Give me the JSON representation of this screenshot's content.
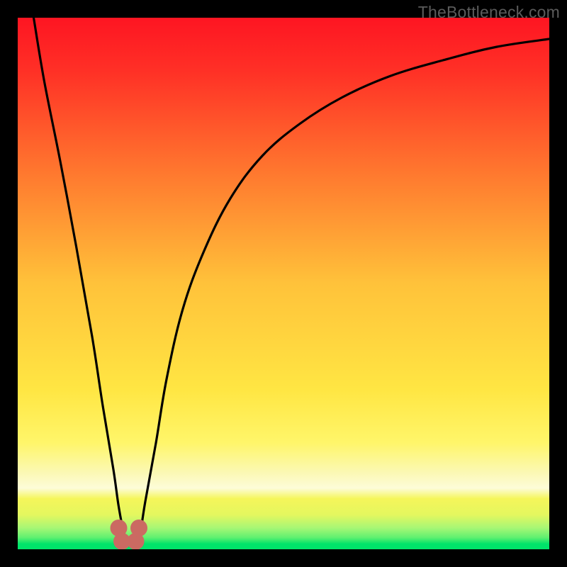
{
  "watermark": "TheBottleneck.com",
  "colors": {
    "frame": "#000000",
    "top": "#fe1522",
    "mid": "#ffe643",
    "cream": "#fbf8b3",
    "yellow2": "#f5f65a",
    "lightgreen": "#a6f775",
    "green": "#00e46a",
    "curve": "#000000",
    "marker": "#cb6a62"
  },
  "gradient_stops": [
    {
      "offset": 0.0,
      "color": "#fe1522"
    },
    {
      "offset": 0.1,
      "color": "#ff3026"
    },
    {
      "offset": 0.3,
      "color": "#ff7b2f"
    },
    {
      "offset": 0.5,
      "color": "#ffc23a"
    },
    {
      "offset": 0.7,
      "color": "#ffe643"
    },
    {
      "offset": 0.8,
      "color": "#fff66a"
    },
    {
      "offset": 0.855,
      "color": "#fbf8b3"
    },
    {
      "offset": 0.885,
      "color": "#fdfcd8"
    },
    {
      "offset": 0.905,
      "color": "#f5f65a"
    },
    {
      "offset": 0.935,
      "color": "#e4f75f"
    },
    {
      "offset": 0.96,
      "color": "#a6f775"
    },
    {
      "offset": 0.978,
      "color": "#5ff070"
    },
    {
      "offset": 0.99,
      "color": "#00e46a"
    },
    {
      "offset": 1.0,
      "color": "#00e46a"
    }
  ],
  "chart_data": {
    "type": "line",
    "title": "",
    "xlabel": "",
    "ylabel": "",
    "xlim": [
      0,
      100
    ],
    "ylim": [
      0,
      100
    ],
    "series": [
      {
        "name": "bottleneck-curve",
        "x": [
          3,
          5,
          8,
          11,
          14,
          16,
          18,
          19,
          20,
          21,
          22,
          23,
          24,
          26,
          28,
          31,
          35,
          40,
          46,
          53,
          61,
          70,
          80,
          90,
          100
        ],
        "y": [
          100,
          88,
          73,
          57,
          40,
          27,
          15,
          8,
          3,
          1,
          1,
          3,
          9,
          20,
          32,
          45,
          56,
          66,
          74,
          80,
          85,
          89,
          92,
          94.5,
          96
        ]
      }
    ],
    "markers": [
      {
        "x": 19.0,
        "y": 4.0
      },
      {
        "x": 19.6,
        "y": 1.5
      },
      {
        "x": 22.2,
        "y": 1.5
      },
      {
        "x": 22.8,
        "y": 4.0
      }
    ],
    "marker_radius_px": 12
  }
}
